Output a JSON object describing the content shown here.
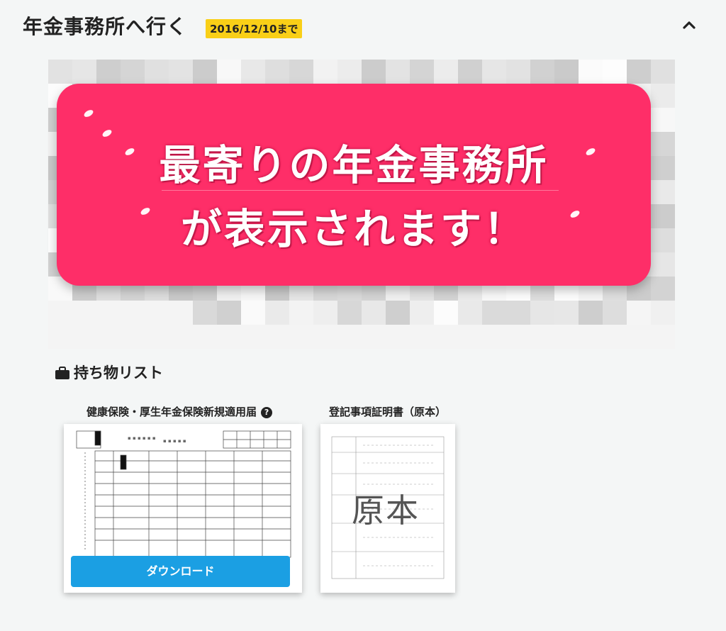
{
  "header": {
    "title": "年金事務所へ行く",
    "deadline": "2016/12/10まで",
    "collapse_icon": "chevron-up-icon"
  },
  "overlay": {
    "line1": "最寄りの年金事務所",
    "line2": "が表示されます！",
    "color": "#fe2e68"
  },
  "checklist": {
    "heading": "持ち物リスト",
    "icon": "briefcase-icon"
  },
  "documents": [
    {
      "title": "健康保険・厚生年金保険新規適用届",
      "help_icon": "question-icon",
      "button_label": "ダウンロード"
    },
    {
      "title": "登記事項証明書（原本）",
      "stamp": "原本"
    }
  ],
  "colors": {
    "accent_yellow": "#f9cf17",
    "button_blue": "#1b9fe3",
    "background": "#f4f6f6"
  }
}
